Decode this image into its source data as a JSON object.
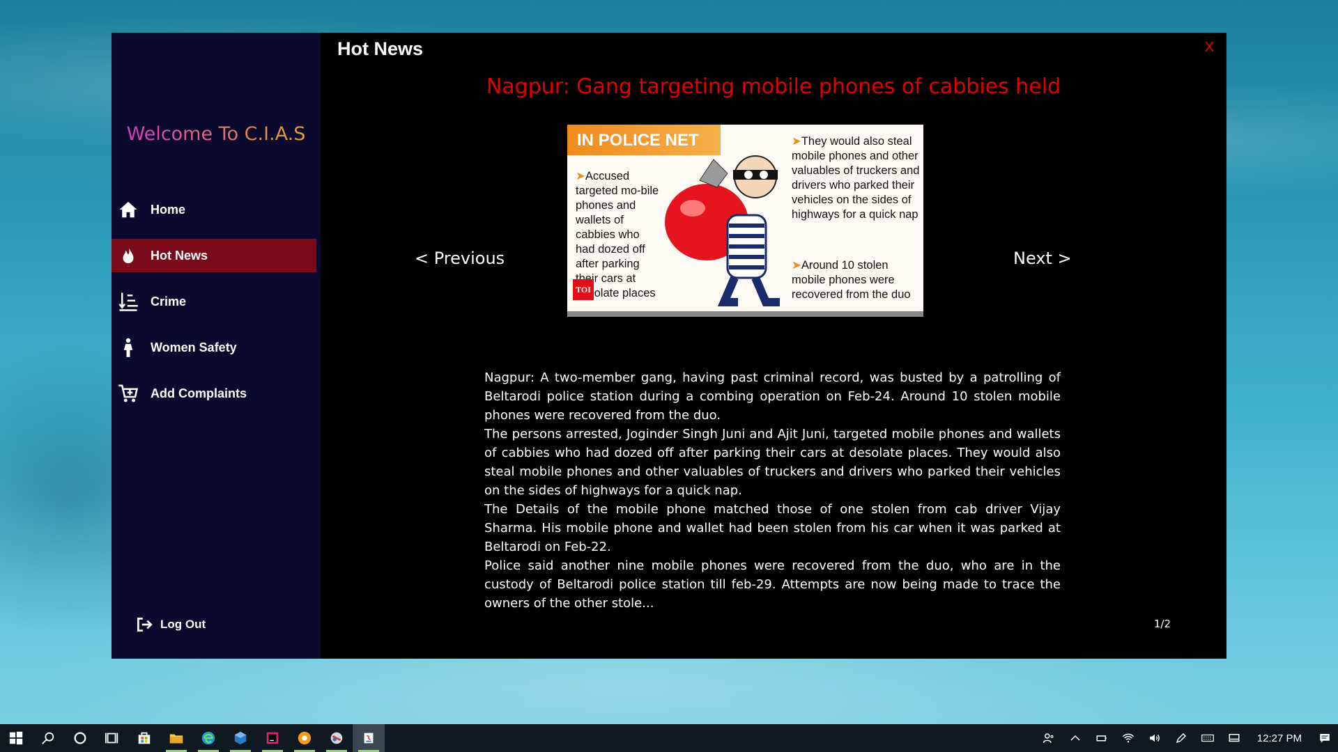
{
  "app": {
    "welcome": "Welcome To C.I.A.S",
    "page_title": "Hot News",
    "close_label": "X"
  },
  "sidebar": {
    "items": [
      {
        "label": "Home",
        "icon": "home-icon"
      },
      {
        "label": "Hot News",
        "icon": "flame-icon"
      },
      {
        "label": "Crime",
        "icon": "sort-descending-icon"
      },
      {
        "label": "Women Safety",
        "icon": "woman-icon"
      },
      {
        "label": "Add Complaints",
        "icon": "cart-add-icon"
      }
    ],
    "logout": "Log Out"
  },
  "news": {
    "headline": "Nagpur: Gang targeting mobile phones of cabbies held",
    "prev_label": "< Previous",
    "next_label": "Next >",
    "image": {
      "banner": "IN POLICE NET",
      "left_text": "Accused targeted mo-bile phones and wallets of cabbies who had dozed off after parking their cars at desolate places",
      "right_text": "They would also steal mobile phones and other valuables of truckers and drivers who parked their vehicles on the sides of highways for a quick nap",
      "right_text2": "Around 10 stolen mobile phones were recovered from the duo",
      "badge": "TOI"
    },
    "paragraphs": [
      "Nagpur: A two-member gang, having past criminal record, was busted by a patrolling of Beltarodi police station during a combing operation on Feb-24. Around 10 stolen mobile phones were recovered from the duo.",
      "The persons arrested, Joginder Singh Juni and Ajit Juni, targeted mobile phones and wallets of cabbies who had dozed off after parking their cars at desolate places. They would also steal mobile phones and other valuables of truckers and drivers who parked their vehicles on the sides of highways for a quick nap.",
      "The Details of the mobile phone matched those of one stolen from cab driver Vijay Sharma. His mobile phone and wallet had been stolen from his car when it was parked at Beltarodi on Feb-22.",
      "Police said another nine mobile phones were recovered from the duo, who are in the custody of Beltarodi police station till feb-29. Attempts are now being made to trace the owners of the other stole..."
    ],
    "page_indicator": "1/2"
  },
  "taskbar": {
    "clock": "12:27 PM"
  },
  "colors": {
    "sidebar_bg": "#0b0a2e",
    "active_item": "#7a0a17",
    "headline": "#e50000",
    "close": "#e00000"
  }
}
